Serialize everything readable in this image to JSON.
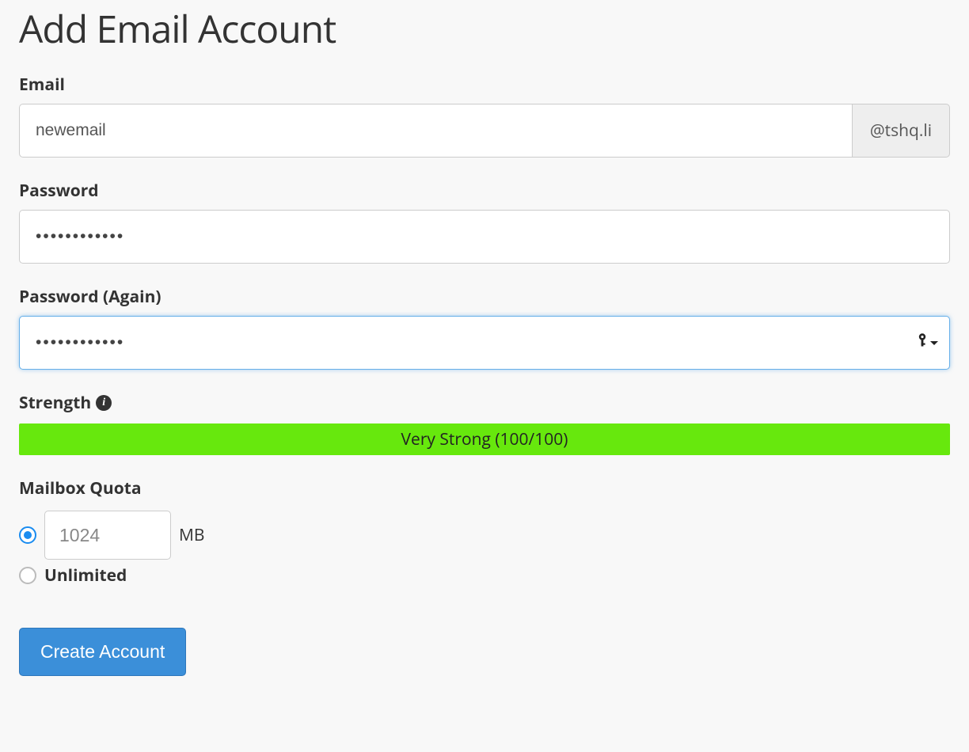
{
  "page": {
    "title": "Add Email Account"
  },
  "form": {
    "email": {
      "label": "Email",
      "value": "newemail",
      "domain_suffix": "@tshq.li"
    },
    "password": {
      "label": "Password",
      "value": "••••••••••••"
    },
    "password_again": {
      "label": "Password (Again)",
      "value": "••••••••••••"
    },
    "strength": {
      "label": "Strength",
      "info_icon": "i",
      "bar_text": "Very Strong (100/100)",
      "bar_color": "#67e80d"
    },
    "quota": {
      "label": "Mailbox Quota",
      "value": "1024",
      "unit": "MB",
      "unlimited_label": "Unlimited",
      "selected": "limited"
    },
    "submit_label": "Create Account"
  }
}
